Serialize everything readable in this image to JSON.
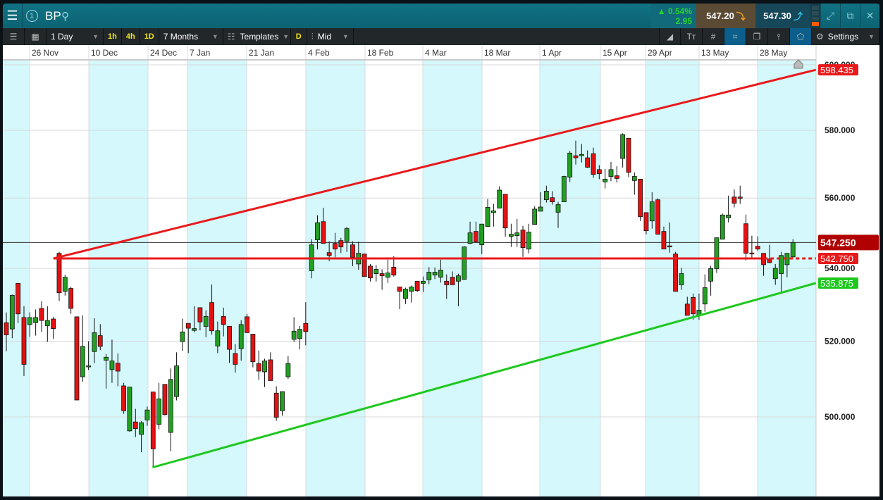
{
  "header": {
    "symbol": "BP",
    "workspace": "1",
    "change_pct": "▲ 0.54%",
    "change_abs": "2.95",
    "bid": "547.20",
    "ask": "547.30"
  },
  "toolbar": {
    "interval": "1 Day",
    "quick": [
      "1h",
      "4h",
      "1D"
    ],
    "range": "7 Months",
    "templates": "Templates",
    "d_label": "D",
    "price_type": "Mid",
    "settings": "Settings"
  },
  "colors": {
    "up": "#22a022",
    "down": "#e31212",
    "band": "#d4f8fb",
    "red_line": "#e8191b",
    "green_line": "#1ec81e",
    "current_badge": "#b00000"
  },
  "chart_data": {
    "type": "candlestick",
    "symbol": "BP",
    "interval": "1 Day",
    "scale": "log",
    "date_labels": [
      "26 Nov",
      "10 Dec",
      "24 Dec",
      "7 Jan",
      "21 Jan",
      "4 Feb",
      "18 Feb",
      "4 Mar",
      "18 Mar",
      "1 Apr",
      "15 Apr",
      "29 Apr",
      "13 May",
      "28 May"
    ],
    "y_ticks": [
      "600.000",
      "580.000",
      "560.000",
      "540.000",
      "520.000",
      "500.000"
    ],
    "y_tick_values": [
      600,
      580,
      560,
      540,
      520,
      500
    ],
    "ylim": [
      480,
      606
    ],
    "current_price": {
      "value": 547.25,
      "label": "547.250"
    },
    "lines": [
      {
        "name": "upper-resistance-trendline",
        "color": "#e8191b",
        "from": {
          "index": 8,
          "price": 542.75
        },
        "to": {
          "index": 137.9,
          "price": 598.435
        },
        "label": "598.435"
      },
      {
        "name": "horizontal-support-line",
        "color": "#e8191b",
        "from": {
          "index": 8,
          "price": 542.75
        },
        "to": {
          "index": 137.9,
          "price": 542.75
        },
        "dashed_from_index": 128,
        "label": "542.750"
      },
      {
        "name": "lower-support-trendline",
        "color": "#1ec81e",
        "from": {
          "index": 24.9,
          "price": 487.1
        },
        "to": {
          "index": 137.9,
          "price": 535.875
        },
        "label": "535.875"
      }
    ],
    "candles_ohlc": [
      [
        525.0,
        527.8,
        517.3,
        521.7
      ],
      [
        523.3,
        532.7,
        520.8,
        532.5
      ],
      [
        535.8,
        535.8,
        524.9,
        527.4
      ],
      [
        526.4,
        529.5,
        510.7,
        513.8
      ],
      [
        524.5,
        527.8,
        521.2,
        526.4
      ],
      [
        525.0,
        528.6,
        521.5,
        526.4
      ],
      [
        528.9,
        530.9,
        522.5,
        525.6
      ],
      [
        524.2,
        529.5,
        519.8,
        525.6
      ],
      [
        526.0,
        526.6,
        520.6,
        523.4
      ],
      [
        544.2,
        544.6,
        530.9,
        533.2
      ],
      [
        533.6,
        538.2,
        532.4,
        537.5
      ],
      [
        534.4,
        534.9,
        527.4,
        528.9
      ],
      [
        526.6,
        526.6,
        504.4,
        504.4
      ],
      [
        510.5,
        527.0,
        509.2,
        518.6
      ],
      [
        513.2,
        520.0,
        512.3,
        513.4
      ],
      [
        517.2,
        526.2,
        514.1,
        522.3
      ],
      [
        521.5,
        524.6,
        517.6,
        518.6
      ],
      [
        514.9,
        516.6,
        507.4,
        515.7
      ],
      [
        512.4,
        520.4,
        508.9,
        514.7
      ],
      [
        514.1,
        516.7,
        508.0,
        512.0
      ],
      [
        508.1,
        508.9,
        500.8,
        501.6
      ],
      [
        496.4,
        507.8,
        496.2,
        507.8
      ],
      [
        498.7,
        502.1,
        494.8,
        497.0
      ],
      [
        495.5,
        498.9,
        491.0,
        498.5
      ],
      [
        499.2,
        502.7,
        497.7,
        501.8
      ],
      [
        506.5,
        506.5,
        487.1,
        491.8
      ],
      [
        498.1,
        508.9,
        496.8,
        504.7
      ],
      [
        508.5,
        508.5,
        500.4,
        500.6
      ],
      [
        496.0,
        512.7,
        491.2,
        509.8
      ],
      [
        505.3,
        517.0,
        504.3,
        513.4
      ],
      [
        519.9,
        526.1,
        517.4,
        522.5
      ],
      [
        524.8,
        524.8,
        516.8,
        523.5
      ],
      [
        522.9,
        529.5,
        522.4,
        523.4
      ],
      [
        529.1,
        529.1,
        522.9,
        525.2
      ],
      [
        524.0,
        528.4,
        521.1,
        526.7
      ],
      [
        530.5,
        535.5,
        521.8,
        522.8
      ],
      [
        518.7,
        525.3,
        516.8,
        522.8
      ],
      [
        526.7,
        529.1,
        521.3,
        524.5
      ],
      [
        524.0,
        524.0,
        514.2,
        517.8
      ],
      [
        516.7,
        519.2,
        511.6,
        513.8
      ],
      [
        518.0,
        525.7,
        514.8,
        524.5
      ],
      [
        526.6,
        527.4,
        522.3,
        522.3
      ],
      [
        521.9,
        521.9,
        513.0,
        514.5
      ],
      [
        514.0,
        517.5,
        509.7,
        512.0
      ],
      [
        511.8,
        515.3,
        507.8,
        514.7
      ],
      [
        515.0,
        517.0,
        509.5,
        509.5
      ],
      [
        506.2,
        508.0,
        499.0,
        499.9
      ],
      [
        501.6,
        506.6,
        500.3,
        506.6
      ],
      [
        510.5,
        516.0,
        509.9,
        514.0
      ],
      [
        520.5,
        526.5,
        519.8,
        522.7
      ],
      [
        520.7,
        524.1,
        517.8,
        523.2
      ],
      [
        524.8,
        530.6,
        518.9,
        522.6
      ],
      [
        539.3,
        548.2,
        537.2,
        546.6
      ],
      [
        548.0,
        555.0,
        545.3,
        552.9
      ],
      [
        553.2,
        557.2,
        547.0,
        547.0
      ],
      [
        544.4,
        547.6,
        542.0,
        543.6
      ],
      [
        547.0,
        550.0,
        543.1,
        545.4
      ],
      [
        547.8,
        548.6,
        544.3,
        546.0
      ],
      [
        547.6,
        551.7,
        544.6,
        551.2
      ],
      [
        546.6,
        547.6,
        540.6,
        543.1
      ],
      [
        541.2,
        547.5,
        539.6,
        544.2
      ],
      [
        544.0,
        544.0,
        537.7,
        537.7
      ],
      [
        540.6,
        541.2,
        536.3,
        537.3
      ],
      [
        538.5,
        540.9,
        536.3,
        539.7
      ],
      [
        538.5,
        539.7,
        534.0,
        537.9
      ],
      [
        537.5,
        542.4,
        535.9,
        538.7
      ],
      [
        540.3,
        543.4,
        537.7,
        538.1
      ],
      [
        534.8,
        534.8,
        528.7,
        533.6
      ],
      [
        531.6,
        534.6,
        530.1,
        534.2
      ],
      [
        533.6,
        535.2,
        530.5,
        534.8
      ],
      [
        536.4,
        536.4,
        533.4,
        533.8
      ],
      [
        535.8,
        537.7,
        533.4,
        536.4
      ],
      [
        536.8,
        540.3,
        535.6,
        538.9
      ],
      [
        538.1,
        540.2,
        537.0,
        538.9
      ],
      [
        537.5,
        542.4,
        536.0,
        539.5
      ],
      [
        536.4,
        538.3,
        531.5,
        535.4
      ],
      [
        537.5,
        539.1,
        535.4,
        535.4
      ],
      [
        536.4,
        538.5,
        529.5,
        537.9
      ],
      [
        536.9,
        546.2,
        536.9,
        546.0
      ],
      [
        547.0,
        553.2,
        546.8,
        550.0
      ],
      [
        550.4,
        553.2,
        547.4,
        547.4
      ],
      [
        546.6,
        552.5,
        544.0,
        552.5
      ],
      [
        551.8,
        559.7,
        551.8,
        557.3
      ],
      [
        555.8,
        558.3,
        551.8,
        556.3
      ],
      [
        557.1,
        563.4,
        557.1,
        562.3
      ],
      [
        561.1,
        561.1,
        548.9,
        551.4
      ],
      [
        549.0,
        552.6,
        546.0,
        549.6
      ],
      [
        549.2,
        554.0,
        546.0,
        550.0
      ],
      [
        550.8,
        552.0,
        543.2,
        545.8
      ],
      [
        545.4,
        552.6,
        544.2,
        550.2
      ],
      [
        552.4,
        557.6,
        552.4,
        556.8
      ],
      [
        556.2,
        561.7,
        556.2,
        557.4
      ],
      [
        559.5,
        563.6,
        558.7,
        562.0
      ],
      [
        560.1,
        562.0,
        558.1,
        558.9
      ],
      [
        555.9,
        558.9,
        551.4,
        558.1
      ],
      [
        558.9,
        566.5,
        558.9,
        566.3
      ],
      [
        566.1,
        573.8,
        564.7,
        573.2
      ],
      [
        572.4,
        576.9,
        569.8,
        571.8
      ],
      [
        572.4,
        575.9,
        570.4,
        572.8
      ],
      [
        571.8,
        574.0,
        568.8,
        569.0
      ],
      [
        573.0,
        574.8,
        565.9,
        566.9
      ],
      [
        568.3,
        569.6,
        565.5,
        567.1
      ],
      [
        564.7,
        568.5,
        562.8,
        565.5
      ],
      [
        566.3,
        570.6,
        564.9,
        568.3
      ],
      [
        566.5,
        569.3,
        564.5,
        565.7
      ],
      [
        571.6,
        579.1,
        568.9,
        578.7
      ],
      [
        577.6,
        577.6,
        566.1,
        567.5
      ],
      [
        565.1,
        567.5,
        561.0,
        566.3
      ],
      [
        565.5,
        565.5,
        553.4,
        554.6
      ],
      [
        555.8,
        555.8,
        549.6,
        550.6
      ],
      [
        553.4,
        561.7,
        551.2,
        558.9
      ],
      [
        559.5,
        559.9,
        549.6,
        549.6
      ],
      [
        550.4,
        551.8,
        545.4,
        545.4
      ],
      [
        546.3,
        553.0,
        544.4,
        546.1
      ],
      [
        544.0,
        544.6,
        533.6,
        533.6
      ],
      [
        535.4,
        540.1,
        534.0,
        538.5
      ],
      [
        530.1,
        532.1,
        527.0,
        527.0
      ],
      [
        531.9,
        533.0,
        525.8,
        527.4
      ],
      [
        527.0,
        533.0,
        525.8,
        528.4
      ],
      [
        530.1,
        538.3,
        528.0,
        534.6
      ],
      [
        536.4,
        540.7,
        532.4,
        539.9
      ],
      [
        539.9,
        548.6,
        538.7,
        548.6
      ],
      [
        548.2,
        555.5,
        548.2,
        555.1
      ],
      [
        554.3,
        560.7,
        553.0,
        555.1
      ],
      [
        560.3,
        562.5,
        557.3,
        558.5
      ],
      [
        560.3,
        563.6,
        558.3,
        559.9
      ],
      [
        552.6,
        555.2,
        542.2,
        544.2
      ],
      [
        544.3,
        549.2,
        543.0,
        544.1
      ],
      [
        546.2,
        549.0,
        544.8,
        545.4
      ],
      [
        544.2,
        544.2,
        537.9,
        541.0
      ],
      [
        542.6,
        546.6,
        541.4,
        541.6
      ],
      [
        537.1,
        541.2,
        535.4,
        540.0
      ],
      [
        538.5,
        544.6,
        533.4,
        543.6
      ],
      [
        541.0,
        544.2,
        537.5,
        544.2
      ],
      [
        543.2,
        548.2,
        543.0,
        547.25
      ]
    ]
  }
}
